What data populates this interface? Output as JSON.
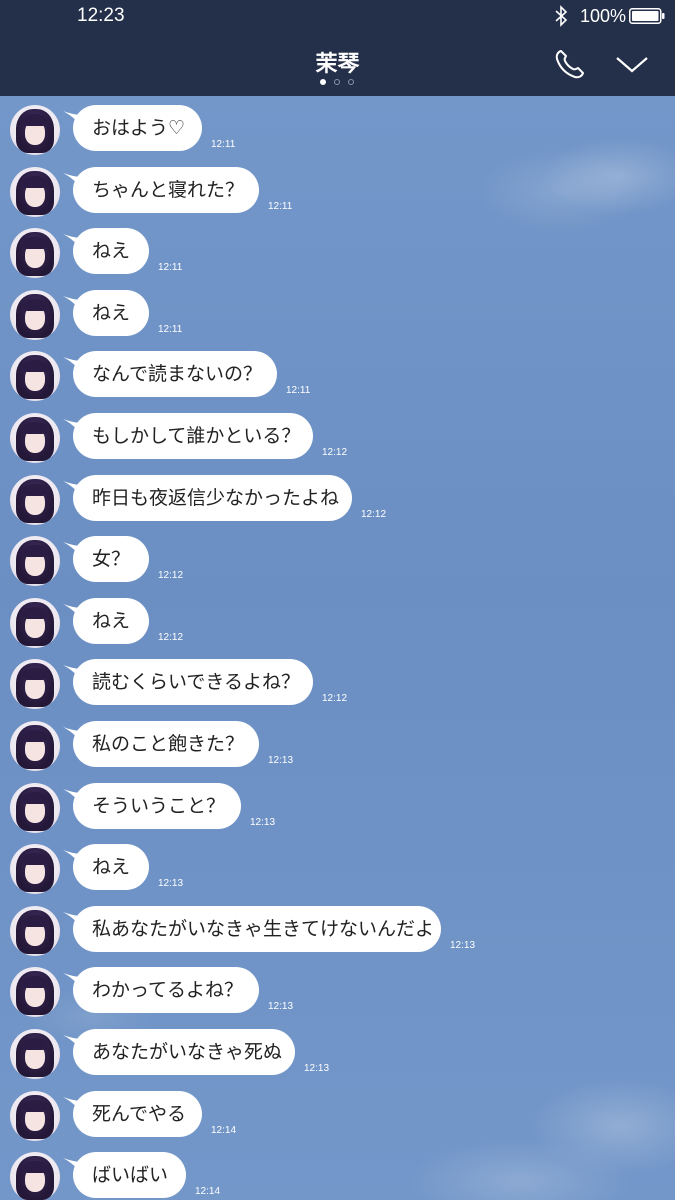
{
  "status_bar": {
    "time": "12:23",
    "battery": "100%"
  },
  "header": {
    "title": "茉琴"
  },
  "messages": [
    {
      "text": "おはよう♡",
      "time": "12:11"
    },
    {
      "text": "ちゃんと寝れた？",
      "time": "12:11"
    },
    {
      "text": "ねえ",
      "time": "12:11"
    },
    {
      "text": "ねえ",
      "time": "12:11"
    },
    {
      "text": "なんで読まないの？",
      "time": "12:11"
    },
    {
      "text": "もしかして誰かといる？",
      "time": "12:12"
    },
    {
      "text": "昨日も夜返信少なかったよね",
      "time": "12:12"
    },
    {
      "text": "女？",
      "time": "12:12"
    },
    {
      "text": "ねえ",
      "time": "12:12"
    },
    {
      "text": "読むくらいできるよね？",
      "time": "12:12"
    },
    {
      "text": "私のこと飽きた？",
      "time": "12:13"
    },
    {
      "text": "そういうこと？",
      "time": "12:13"
    },
    {
      "text": "ねえ",
      "time": "12:13"
    },
    {
      "text": "私あなたがいなきゃ生きてけないんだよ",
      "time": "12:13"
    },
    {
      "text": "わかってるよね？",
      "time": "12:13"
    },
    {
      "text": "あなたがいなきゃ死ぬ",
      "time": "12:13"
    },
    {
      "text": "死んでやる",
      "time": "12:14"
    },
    {
      "text": "ばいばい",
      "time": "12:14"
    }
  ]
}
